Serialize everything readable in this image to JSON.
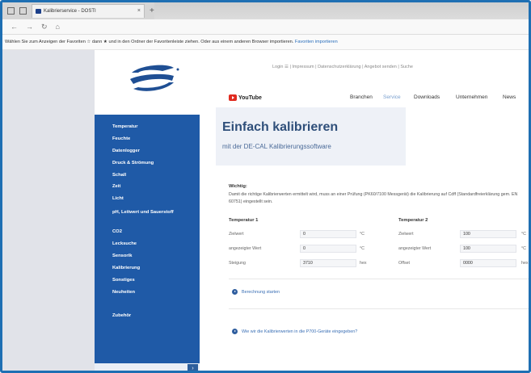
{
  "browser": {
    "tab_title": "Kalibrierservice - DOSTI",
    "tab_close": "×",
    "new_tab": "+",
    "address_icons": [
      "←",
      "→",
      "↻",
      "⌂"
    ],
    "favorites_hint": "Wählen Sie zum Anzeigen der Favoriten ☆ dann ★ und in den Ordner der Favoritenleiste ziehen. Oder aus einem anderen Browser importieren.",
    "favorites_link": "Favoriten importieren"
  },
  "sidebar": {
    "items": [
      "Temperatur",
      "Feuchte",
      "Datenlogger",
      "Druck & Strömung",
      "Schall",
      "Zeit",
      "Licht",
      "pH, Leitwert und Sauerstoff",
      "CO2",
      "Lecksuche",
      "Sensorik",
      "Kalibrierung",
      "Sonstiges",
      "Neuheiten",
      "Zubehör"
    ],
    "search_button": "›"
  },
  "header": {
    "top_links": "Login  ☰  |  Impressum  |  Datenschutzerklärung  |  Angebot senden  |  Suche",
    "youtube_label": "YouTube",
    "menu": [
      "Branchen",
      "Service",
      "Downloads",
      "Unternehmen",
      "News"
    ]
  },
  "hero": {
    "title": "Einfach kalibrieren",
    "subtitle": "mit der DE-CAL Kalibrierungssoftware"
  },
  "notice": {
    "title": "Wichtig:",
    "text": "Damit die richtige Kalibrierwerten ermittelt wird, muss an einer Prüfung (PK60/7100 Messgerät) die Kalibrierung auf Cdff (Standardfreierklärung gem. EN 60751) eingestellt sein."
  },
  "calc": {
    "col1_title": "Temperatur 1",
    "col2_title": "Temperatur 2",
    "rows1": [
      {
        "label": "Zielwert",
        "value": "0",
        "unit": "°C"
      },
      {
        "label": "angezeigter Wert",
        "value": "0",
        "unit": "°C"
      },
      {
        "label": "Steigung",
        "value": "3710",
        "unit": "hex"
      }
    ],
    "rows2": [
      {
        "label": "Zielwert",
        "value": "100",
        "unit": "°C"
      },
      {
        "label": "angezeigter Wert",
        "value": "100",
        "unit": "°C"
      },
      {
        "label": "Offset",
        "value": "0000",
        "unit": "hex"
      }
    ]
  },
  "links": {
    "start": "Berechnung starten",
    "faq": "Wie wir die Kalibrierwerten in die P700-Geräte eingegeben?"
  }
}
